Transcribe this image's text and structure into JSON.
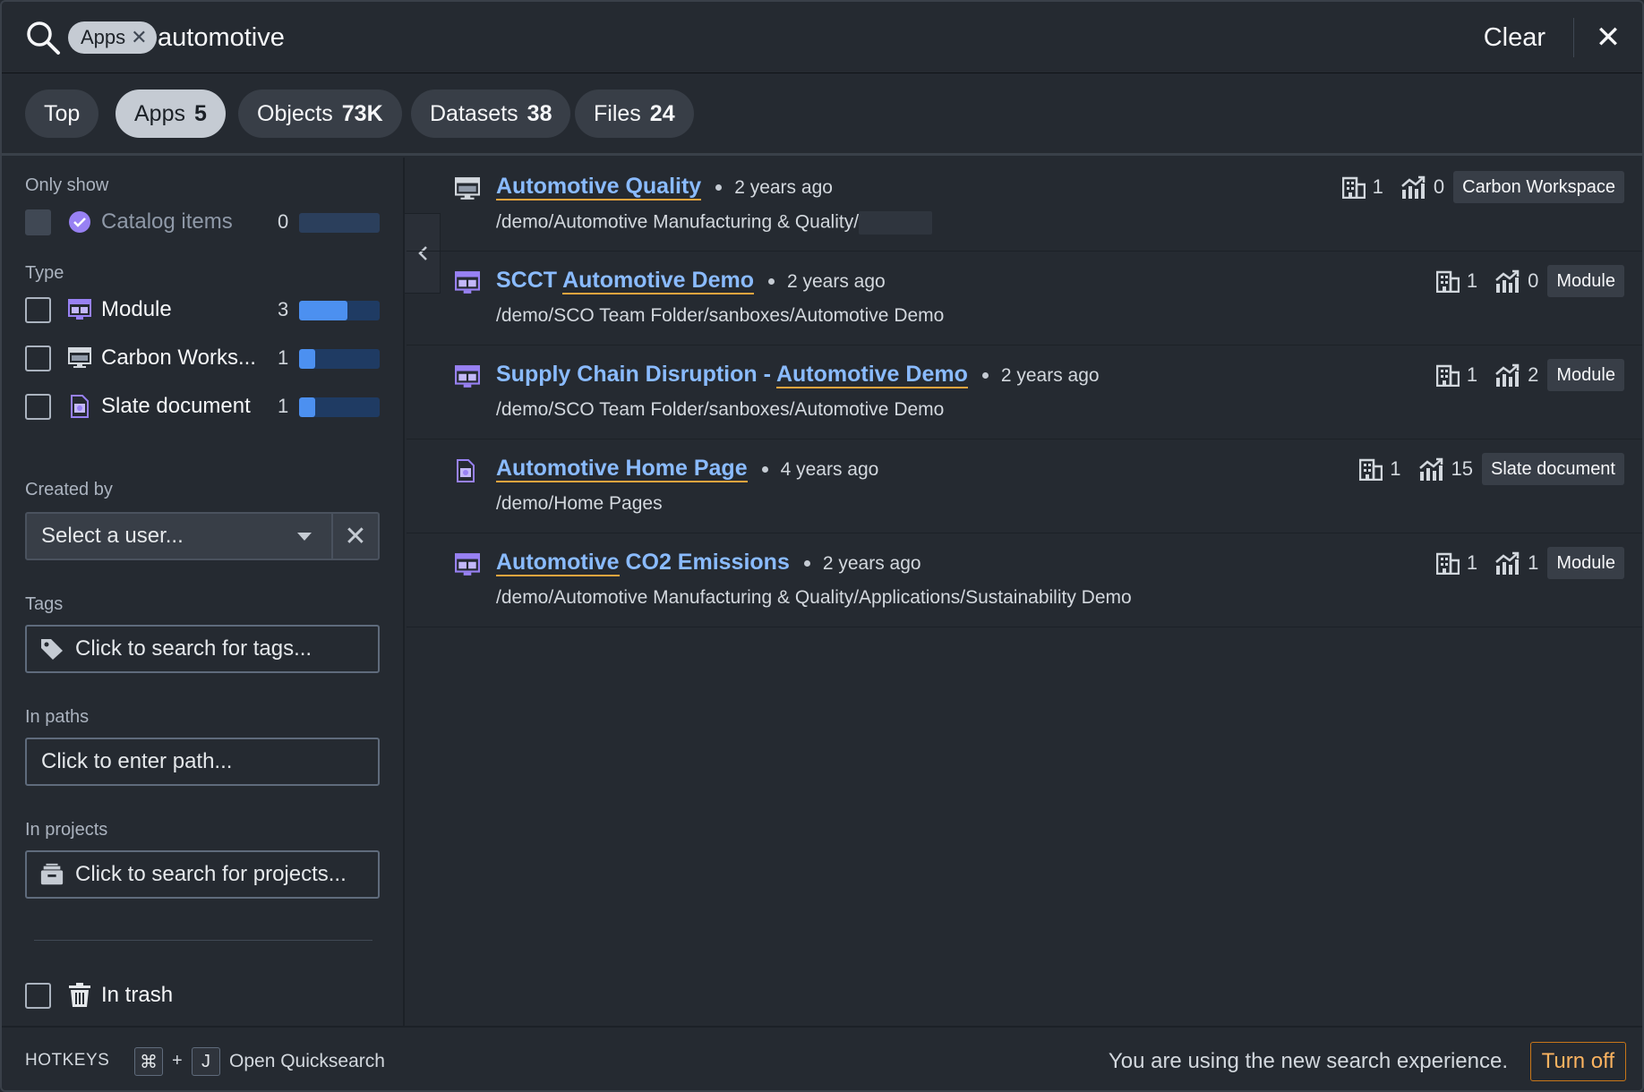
{
  "search": {
    "chip_label": "Apps",
    "query": "automotive",
    "clear_label": "Clear"
  },
  "tabs": [
    {
      "label": "Top",
      "count": ""
    },
    {
      "label": "Apps",
      "count": "5"
    },
    {
      "label": "Objects",
      "count": "73K"
    },
    {
      "label": "Datasets",
      "count": "38"
    },
    {
      "label": "Files",
      "count": "24"
    }
  ],
  "sidebar": {
    "only_show_label": "Only show",
    "catalog": {
      "label": "Catalog items",
      "count": "0"
    },
    "type_label": "Type",
    "types": [
      {
        "label": "Module",
        "count": "3",
        "fill": 0.6
      },
      {
        "label": "Carbon Works...",
        "count": "1",
        "fill": 0.2
      },
      {
        "label": "Slate document",
        "count": "1",
        "fill": 0.2
      }
    ],
    "created_by_label": "Created by",
    "created_by_placeholder": "Select a user...",
    "tags_label": "Tags",
    "tags_placeholder": "Click to search for tags...",
    "paths_label": "In paths",
    "paths_placeholder": "Click to enter path...",
    "projects_label": "In projects",
    "projects_placeholder": "Click to search for projects...",
    "trash_label": "In trash"
  },
  "results": [
    {
      "title_parts": [
        {
          "t": "Automotive Quality",
          "hl": true
        }
      ],
      "time": "2 years ago",
      "path": "/demo/Automotive Manufacturing & Quality/",
      "redacted": true,
      "orgs": "1",
      "views": "0",
      "type": "Carbon Workspace",
      "icon": "carbon-workspace-icon"
    },
    {
      "title_parts": [
        {
          "t": "SCCT ",
          "hl": false
        },
        {
          "t": "Automotive Demo",
          "hl": true
        }
      ],
      "time": "2 years ago",
      "path": "/demo/SCO Team Folder/sanboxes/Automotive Demo",
      "redacted": false,
      "orgs": "1",
      "views": "0",
      "type": "Module",
      "icon": "module-icon"
    },
    {
      "title_parts": [
        {
          "t": "Supply Chain Disruption - ",
          "hl": false
        },
        {
          "t": "Automotive Demo",
          "hl": true
        }
      ],
      "time": "2 years ago",
      "path": "/demo/SCO Team Folder/sanboxes/Automotive Demo",
      "redacted": false,
      "orgs": "1",
      "views": "2",
      "type": "Module",
      "icon": "module-icon"
    },
    {
      "title_parts": [
        {
          "t": "Automotive Home Page",
          "hl": true
        }
      ],
      "time": "4 years ago",
      "path": "/demo/Home Pages",
      "redacted": false,
      "orgs": "1",
      "views": "15",
      "type": "Slate document",
      "icon": "slate-document-icon"
    },
    {
      "title_parts": [
        {
          "t": "Automotive",
          "hl": true
        },
        {
          "t": " CO2 Emissions",
          "hl": false
        }
      ],
      "time": "2 years ago",
      "path": "/demo/Automotive Manufacturing & Quality/Applications/Sustainability Demo",
      "redacted": false,
      "orgs": "1",
      "views": "1",
      "type": "Module",
      "icon": "module-icon"
    }
  ],
  "footer": {
    "hotkeys_label": "HOTKEYS",
    "key1": "⌘",
    "plus": "+",
    "key2": "J",
    "action": "Open Quicksearch",
    "notice": "You are using the new search experience.",
    "turn_off_label": "Turn off"
  },
  "colors": {
    "background": "#252a31",
    "link": "#8abbff",
    "highlight_underline": "#f0a53e",
    "bar_fill": "#4c90f0",
    "turn_off": "#fbb360"
  }
}
